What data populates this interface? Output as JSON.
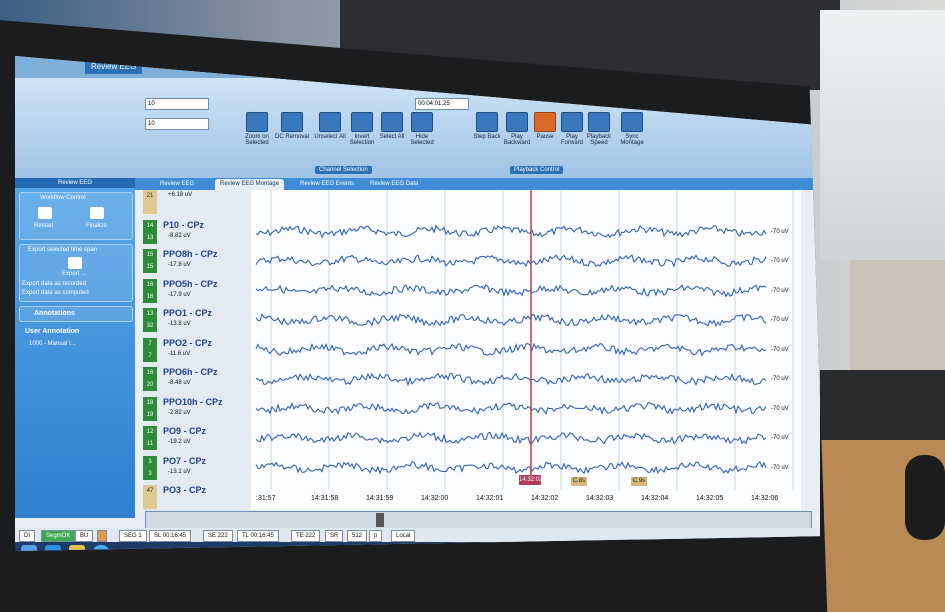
{
  "app": {
    "title_tab": "Review EEG",
    "ribbon": {
      "montage_field": "10",
      "reference_field": "10",
      "time_field": "00:04:01.25",
      "buttons": [
        "Zoom on Selected",
        "DC Removal",
        "Unselect All",
        "Invert Selection",
        "Select All",
        "Hide Selected",
        "Step Back",
        "Play Backward",
        "Pause",
        "Play Forward",
        "Playback Speed",
        "Sync Montage"
      ],
      "group_labels": [
        "Channel Selection",
        "Playback Control"
      ]
    },
    "sidebar": {
      "header": "Review EEG",
      "workflow_title": "Workflow Control",
      "workflow_buttons": [
        "Restart",
        "Finalize"
      ],
      "export_title": "Export selected time span",
      "export_button": "Export ...",
      "export_options": [
        "Export data as recorded",
        "Export data as computed"
      ],
      "annotations_title": "Annotations",
      "user_annotation_title": "User Annotation",
      "annotation_item": "1000 - Manual I..."
    },
    "plot_tabs": [
      "Review EEG",
      "Review EEG Montage",
      "Review EEG Events",
      "Review EEG Data"
    ],
    "channels": [
      {
        "num": [
          "21",
          ""
        ],
        "num_style": "tan",
        "name": "",
        "value": "+6.18 uV"
      },
      {
        "num": [
          "14",
          "13"
        ],
        "num_style": "green",
        "name": "P10 - CPz",
        "value": "-8.82 uV"
      },
      {
        "num": [
          "15",
          "15"
        ],
        "num_style": "green",
        "name": "PPO8h - CPz",
        "value": "-17.8 uV"
      },
      {
        "num": [
          "16",
          "16"
        ],
        "num_style": "green",
        "name": "PPO5h - CPz",
        "value": "-17.9 uV"
      },
      {
        "num": [
          "13",
          "32"
        ],
        "num_style": "green",
        "name": "PPO1 - CPz",
        "value": "-13.8 uV"
      },
      {
        "num": [
          "7",
          "7"
        ],
        "num_style": "green",
        "name": "PPO2 - CPz",
        "value": "-11.6 uV"
      },
      {
        "num": [
          "16",
          "20"
        ],
        "num_style": "green",
        "name": "PPO6h - CPz",
        "value": "-8.48 uV"
      },
      {
        "num": [
          "18",
          "19"
        ],
        "num_style": "green",
        "name": "PPO10h - CPz",
        "value": "-2.82 uV"
      },
      {
        "num": [
          "12",
          "11"
        ],
        "num_style": "green",
        "name": "PO9 - CPz",
        "value": "-19.2 uV"
      },
      {
        "num": [
          "3",
          "3"
        ],
        "num_style": "green",
        "name": "PO7 - CPz",
        "value": "-13.1 uV"
      },
      {
        "num": [
          "47",
          ""
        ],
        "num_style": "tan",
        "name": "PO3 - CPz",
        "value": ""
      }
    ],
    "uv_label": "-70 uV",
    "time_ticks": [
      ":31:57",
      "14:31:58",
      "14:31:59",
      "14:32:00",
      "14:32:01",
      "14:32:02",
      "14:32:03",
      "14:32:04",
      "14:32:05",
      "14:32:06"
    ],
    "cursor_time": "14:32:02",
    "events": [
      "C.8s",
      "C.9s"
    ],
    "statusbar": {
      "cells": [
        "DI",
        "SegmOK",
        "BU",
        "",
        "SEG 1",
        "SL 00:16:45",
        "SE 222",
        "TL 00:16:45",
        "TE 222",
        "SR",
        "512",
        "p",
        "Local"
      ]
    }
  },
  "colors": {
    "trace": "#1f55b8",
    "cursor": "#c63c3c",
    "ribbon_blue": "#3a78bd",
    "sidebar_blue": "#2f7fd0",
    "channel_green": "#2e8b3a"
  }
}
